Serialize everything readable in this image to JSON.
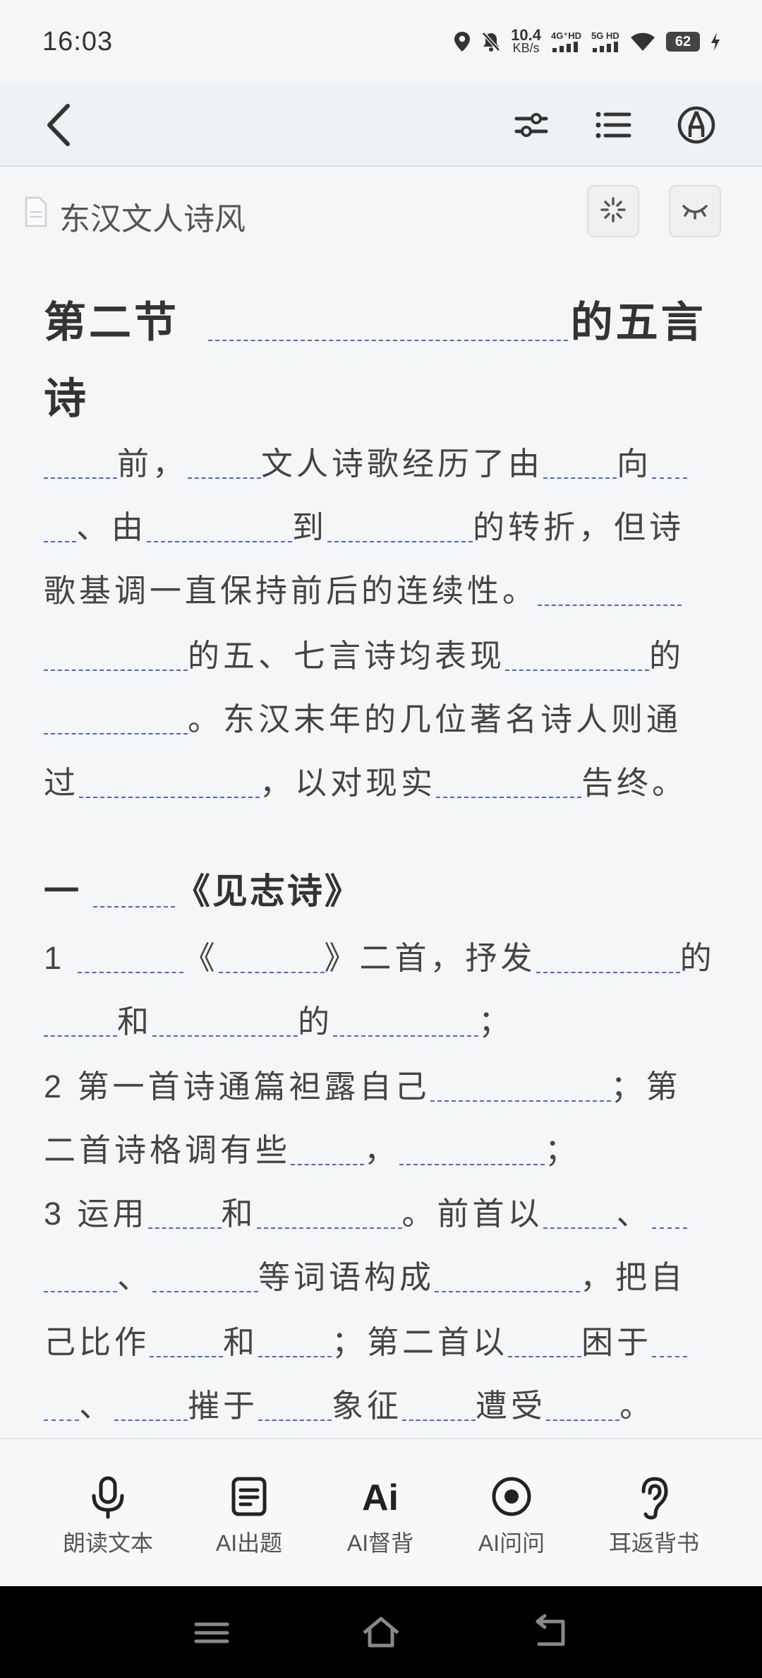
{
  "status": {
    "time": "16:03",
    "net_speed_value": "10.4",
    "net_speed_unit": "KB/s",
    "signal1": "4G⁺HD",
    "signal2": "5G HD",
    "battery": "62"
  },
  "doc": {
    "title": "东汉文人诗风"
  },
  "content": {
    "heading_a": "第二节",
    "heading_b": "的五言",
    "heading_c": "诗",
    "p1": [
      {
        "t": "",
        "b": 104
      },
      {
        "t": "前，",
        "b": 0
      },
      {
        "t": "",
        "b": 104
      },
      {
        "t": "文人诗歌经历了由",
        "b": 0
      },
      {
        "t": "",
        "b": 104
      },
      {
        "t": "向",
        "b": 0
      },
      {
        "t": "",
        "b": 50
      }
    ],
    "p2": [
      {
        "t": "",
        "b": 46
      },
      {
        "t": "、由",
        "b": 0
      },
      {
        "t": "",
        "b": 206
      },
      {
        "t": "到",
        "b": 0
      },
      {
        "t": "",
        "b": 206
      },
      {
        "t": "的转折，但诗",
        "b": 0
      }
    ],
    "p3": [
      {
        "t": "歌基调一直保持前后的连续性。",
        "b": 0
      },
      {
        "t": "",
        "b": 204
      }
    ],
    "p4": [
      {
        "t": "",
        "b": 204
      },
      {
        "t": "的五、七言诗均表现",
        "b": 0
      },
      {
        "t": "",
        "b": 204
      },
      {
        "t": "的",
        "b": 0
      }
    ],
    "p5": [
      {
        "t": "",
        "b": 204
      },
      {
        "t": "。东汉末年的几位著名诗人则通",
        "b": 0
      }
    ],
    "p6": [
      {
        "t": "过",
        "b": 0
      },
      {
        "t": "",
        "b": 256
      },
      {
        "t": "，以对现实",
        "b": 0
      },
      {
        "t": "",
        "b": 206
      },
      {
        "t": "告终。",
        "b": 0
      }
    ],
    "section1": [
      {
        "t": "一 ",
        "b": 0
      },
      {
        "t": "",
        "b": 116
      },
      {
        "t": "《见志诗》",
        "b": 0
      }
    ],
    "q1a": [
      {
        "t": "1 ",
        "b": 0
      },
      {
        "t": "",
        "b": 150
      },
      {
        "t": "《",
        "b": 0
      },
      {
        "t": "",
        "b": 150
      },
      {
        "t": "》二首，抒发",
        "b": 0
      },
      {
        "t": "",
        "b": 204
      },
      {
        "t": "的",
        "b": 0
      }
    ],
    "q1b": [
      {
        "t": "",
        "b": 104
      },
      {
        "t": "和",
        "b": 0
      },
      {
        "t": "",
        "b": 206
      },
      {
        "t": "的",
        "b": 0
      },
      {
        "t": "",
        "b": 206
      },
      {
        "t": "；",
        "b": 0
      }
    ],
    "q2a": [
      {
        "t": "2 第一首诗通篇袒露自己",
        "b": 0
      },
      {
        "t": "",
        "b": 256
      },
      {
        "t": "；第",
        "b": 0
      }
    ],
    "q2b": [
      {
        "t": "二首诗格调有些",
        "b": 0
      },
      {
        "t": "",
        "b": 104
      },
      {
        "t": "，",
        "b": 0
      },
      {
        "t": "",
        "b": 206
      },
      {
        "t": "；",
        "b": 0
      }
    ],
    "q3a": [
      {
        "t": "3 运用",
        "b": 0
      },
      {
        "t": "",
        "b": 104
      },
      {
        "t": "和",
        "b": 0
      },
      {
        "t": "",
        "b": 206
      },
      {
        "t": "。前首以",
        "b": 0
      },
      {
        "t": "",
        "b": 104
      },
      {
        "t": "、",
        "b": 0
      },
      {
        "t": "",
        "b": 50
      }
    ],
    "q3b": [
      {
        "t": "",
        "b": 104
      },
      {
        "t": "、",
        "b": 0
      },
      {
        "t": "",
        "b": 150
      },
      {
        "t": "等词语构成",
        "b": 0
      },
      {
        "t": "",
        "b": 206
      },
      {
        "t": "，把自",
        "b": 0
      }
    ],
    "q3c": [
      {
        "t": "己比作",
        "b": 0
      },
      {
        "t": "",
        "b": 104
      },
      {
        "t": "和",
        "b": 0
      },
      {
        "t": "",
        "b": 104
      },
      {
        "t": "；第二首以",
        "b": 0
      },
      {
        "t": "",
        "b": 104
      },
      {
        "t": "困于",
        "b": 0
      },
      {
        "t": "",
        "b": 50
      }
    ],
    "q3d": [
      {
        "t": "",
        "b": 50
      },
      {
        "t": "、",
        "b": 0
      },
      {
        "t": "",
        "b": 104
      },
      {
        "t": "摧于",
        "b": 0
      },
      {
        "t": "",
        "b": 104
      },
      {
        "t": "象征",
        "b": 0
      },
      {
        "t": "",
        "b": 104
      },
      {
        "t": "遭受",
        "b": 0
      },
      {
        "t": "",
        "b": 104
      },
      {
        "t": "。",
        "b": 0
      }
    ]
  },
  "bottom_tabs": [
    {
      "label": "朗读文本",
      "icon": "microphone-icon"
    },
    {
      "label": "AI出题",
      "icon": "document-icon"
    },
    {
      "label": "AI督背",
      "icon": "ai-icon",
      "glyph": "Ai"
    },
    {
      "label": "AI问问",
      "icon": "target-icon"
    },
    {
      "label": "耳返背书",
      "icon": "ear-icon"
    }
  ],
  "colors": {
    "blank_underline": "#4b67c9",
    "background": "#f4f6f8",
    "nav": "#000000"
  }
}
